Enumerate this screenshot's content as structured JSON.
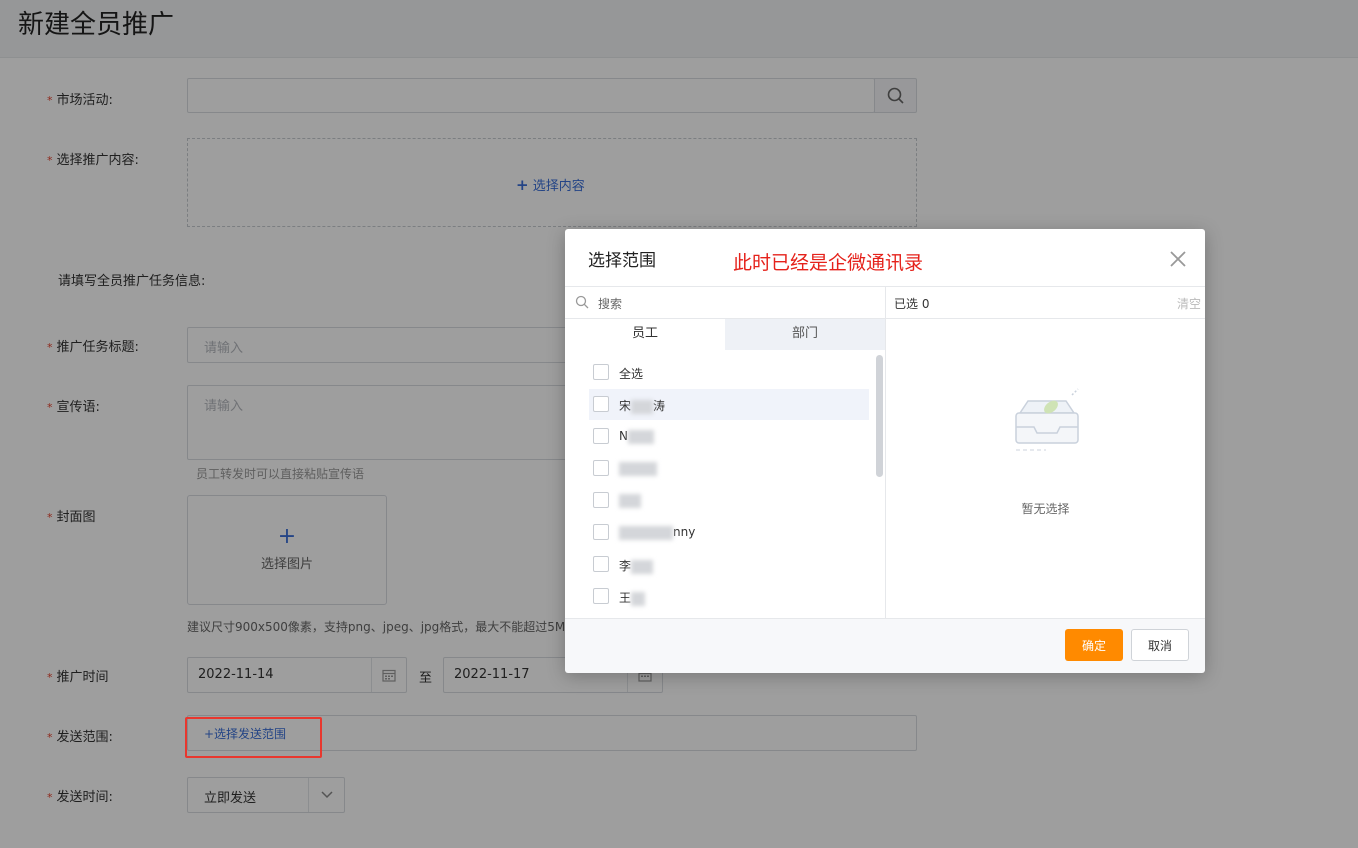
{
  "page": {
    "title": "新建全员推广"
  },
  "form": {
    "marketing_activity_label": "市场活动:",
    "content_label": "选择推广内容:",
    "select_content_link": "选择内容",
    "task_info_heading": "请填写全员推广任务信息:",
    "task_title_label": "推广任务标题:",
    "task_title_placeholder": "请输入",
    "slogan_label": "宣传语:",
    "slogan_placeholder": "请输入",
    "slogan_hint": "员工转发时可以直接粘贴宣传语",
    "cover_label": "封面图",
    "cover_select_label": "选择图片",
    "cover_hint": "建议尺寸900x500像素，支持png、jpeg、jpg格式，最大不能超过5M;",
    "time_label": "推广时间",
    "start_date": "2022-11-14",
    "to_label": "至",
    "end_date": "2022-11-17",
    "scope_label": "发送范围:",
    "scope_link": "+选择发送范围",
    "send_time_label": "发送时间:",
    "send_time_value": "立即发送"
  },
  "modal": {
    "title": "选择范围",
    "note": "此时已经是企微通讯录",
    "search_placeholder": "搜索",
    "tab_employees": "员工",
    "tab_departments": "部门",
    "select_all": "全选",
    "employees": [
      {
        "visible": "宋",
        "tail": "涛"
      },
      {
        "visible": "N",
        "tail": ""
      },
      {
        "visible": "",
        "tail": ""
      },
      {
        "visible": "",
        "tail": ""
      },
      {
        "visible": "",
        "tail": "nny"
      },
      {
        "visible": "李",
        "tail": ""
      },
      {
        "visible": "王",
        "tail": ""
      }
    ],
    "selected_count": "已选 0",
    "clear": "清空",
    "empty_text": "暂无选择",
    "confirm": "确定",
    "cancel": "取消"
  },
  "colors": {
    "accent_orange": "#ff8a00",
    "link_blue": "#3a6fd8",
    "annotation_red": "#e5221b"
  }
}
